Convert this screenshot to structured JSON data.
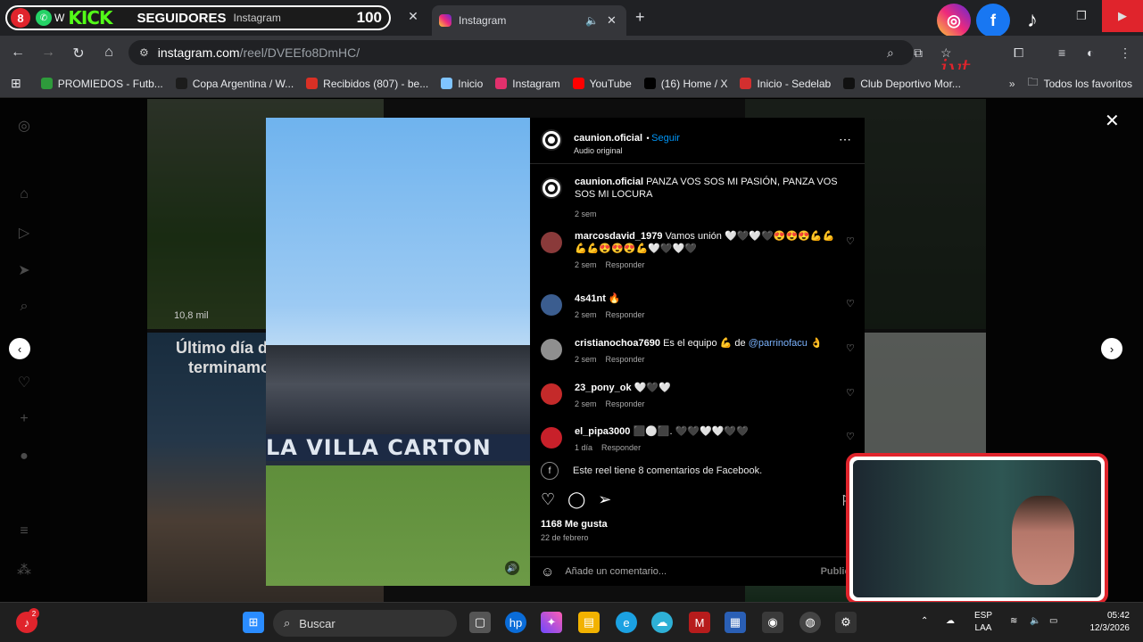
{
  "browser": {
    "tab1": {
      "badge": "8",
      "kick_logo": "KICK",
      "seguidores": "SEGUIDORES",
      "partial_letter": "W",
      "instagram": "Instagram",
      "count": "100"
    },
    "tab2": {
      "title": "Instagram"
    },
    "address": {
      "host": "instagram.com",
      "path": "/reel/DVEEfo8DmHC/"
    },
    "overlay_text": "iyt",
    "bookmarks": [
      {
        "label": "PROMIEDOS - Futb...",
        "color": "#2e9b3b"
      },
      {
        "label": "Copa Argentina / W...",
        "color": "#1c1c1c"
      },
      {
        "label": "Recibidos (807) - be...",
        "color": "#d93025"
      },
      {
        "label": "Inicio",
        "color": "#7fc4ff"
      },
      {
        "label": "Instagram",
        "color": "#e1306c"
      },
      {
        "label": "YouTube",
        "color": "#ff0000"
      },
      {
        "label": "(16) Home / X",
        "color": "#000000"
      },
      {
        "label": "Inicio - Sedelab",
        "color": "#d32f2f"
      },
      {
        "label": "Club Deportivo Mor...",
        "color": "#111111"
      }
    ],
    "all_bookmarks": "Todos los favoritos"
  },
  "background": {
    "views": "10,8 mil",
    "promo_text": [
      "Último día de d",
      "terminamos"
    ]
  },
  "video": {
    "banner_text": "LA VILLA CARTON"
  },
  "post": {
    "author": "caunion.oficial",
    "follow": "Seguir",
    "audio": "Audio original",
    "caption": "PANZA VOS SOS MI PASIÓN, PANZA VOS SOS MI LOCURA",
    "caption_time": "2 sem",
    "comments": [
      {
        "user": "marcosdavid_1979",
        "text": "Vamos unión 🤍🖤🤍🖤😍😍😍💪💪💪💪😍😍😍💪🤍🖤🤍🖤",
        "time": "2 sem",
        "reply": "Responder",
        "avatar": "#8a3a3a"
      },
      {
        "user": "4s41nt",
        "text": "🔥",
        "time": "2 sem",
        "reply": "Responder",
        "avatar": "#3b5d8f"
      },
      {
        "user": "cristianochoa7690",
        "text": "Es el equipo 💪 de ",
        "mention": "@parrinofacu",
        "text_end": " 👌",
        "time": "2 sem",
        "reply": "Responder",
        "avatar": "#8f8f8f"
      },
      {
        "user": "23_pony_ok",
        "text": "🤍🖤🤍",
        "time": "2 sem",
        "reply": "Responder",
        "avatar": "#c42a2a"
      },
      {
        "user": "el_pipa3000",
        "text": "⬛⚪⬛. 🖤🖤🤍🤍🖤🖤",
        "time": "1 día",
        "reply": "Responder",
        "avatar": "#c8202a"
      }
    ],
    "facebook_note": "Este reel tiene 8 comentarios de Facebook.",
    "likes": "1168 Me gusta",
    "date": "22 de febrero",
    "comment_placeholder": "Añade un comentario...",
    "publish": "Publicar"
  },
  "taskbar": {
    "search": "Buscar",
    "lang": [
      "ESP",
      "LAA"
    ],
    "time": "05:42",
    "date": "12/3/2026",
    "notif_badge": "2"
  }
}
